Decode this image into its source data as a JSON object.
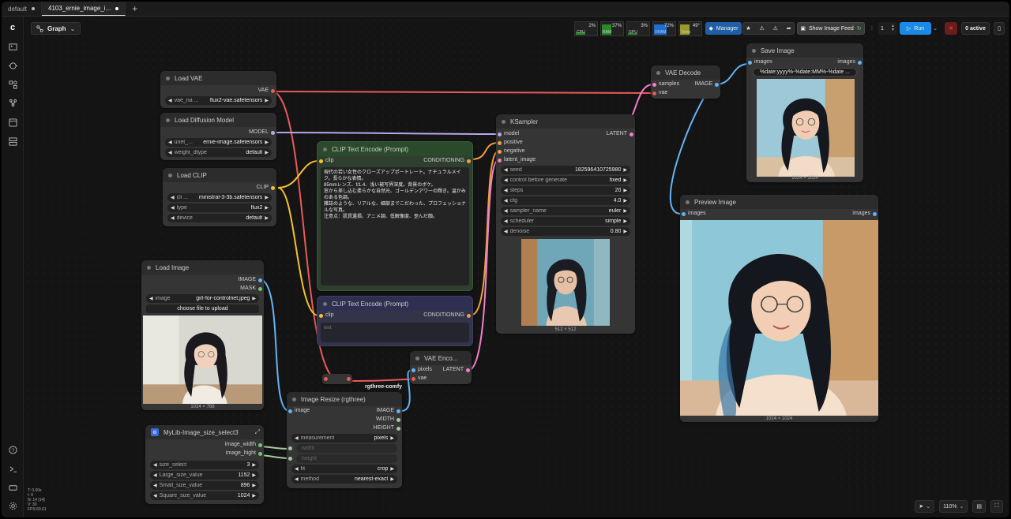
{
  "tabs": [
    {
      "label": "default",
      "active": false
    },
    {
      "label": "4103_ernie_image_i...",
      "active": true
    }
  ],
  "toolbar": {
    "graph_label": "Graph",
    "stats": [
      {
        "label": "CPU",
        "value": "2%",
        "color": "#2a8a2a"
      },
      {
        "label": "RAM",
        "value": "37%",
        "color": "#2a8a2a"
      },
      {
        "label": "GPU",
        "value": "3%",
        "color": "#2a8a2a"
      },
      {
        "label": "VRAM",
        "value": "72%",
        "color": "#1f6fd1"
      },
      {
        "label": "Temp",
        "value": "49°",
        "color": "#9a9a2a"
      }
    ],
    "manager_label": "Manager",
    "show_image_feed_label": "Show Image Feed",
    "batch_count": "1",
    "run_label": "Run",
    "active_label": "0 active",
    "zoom": "110%"
  },
  "stats_overlay": [
    "T: 0.00s",
    "I: 0",
    "N: 14 [14]",
    "V: 30",
    "FPS:60.61"
  ],
  "nodes": {
    "load_vae": {
      "title": "Load VAE",
      "out": "VAE",
      "w_label": "vae_na ...",
      "w_value": "flux2-vae.safetensors"
    },
    "load_diffusion": {
      "title": "Load Diffusion Model",
      "out": "MODEL",
      "w1_label": "unet_...",
      "w1_value": "ernie-image.safetensors",
      "w2_label": "weight_dtype",
      "w2_value": "default"
    },
    "load_clip": {
      "title": "Load CLIP",
      "out": "CLIP",
      "w1_label": "cli ...",
      "w1_value": "ministral-3-3b.safetensors",
      "w2_label": "type",
      "w2_value": "flux2",
      "w3_label": "device",
      "w3_value": "default"
    },
    "clip_pos": {
      "title": "CLIP Text Encode (Prompt)",
      "in": "clip",
      "out": "CONDITIONING",
      "text": "現代の若い女性のクローズアップポートレート。ナチュラルメイク。長らかな表情。\n85mmレンズ、f/1.4、浅い被写界深度。背景のボケ。\n窓から差し込む柔らかな自然光、ゴールデンアワーの輝き。温かみのある色調。\n雑誌のような、リアルな、細部までこだわった、プロフェッショナルな写真。\n注意点：肌質遺損、アニメ調、低解像度、歪んだ顔。"
    },
    "clip_neg": {
      "title": "CLIP Text Encode (Prompt)",
      "in": "clip",
      "out": "CONDITIONING",
      "placeholder": "text"
    },
    "ksampler": {
      "title": "KSampler",
      "inputs": [
        "model",
        "positive",
        "negative",
        "latent_image"
      ],
      "out": "LATENT",
      "widgets": [
        {
          "label": "seed",
          "value": "182596410725980"
        },
        {
          "label": "control before generate",
          "value": "fixed"
        },
        {
          "label": "steps",
          "value": "20"
        },
        {
          "label": "cfg",
          "value": "4.0"
        },
        {
          "label": "sampler_name",
          "value": "euler"
        },
        {
          "label": "scheduler",
          "value": "simple"
        },
        {
          "label": "denoise",
          "value": "0.80"
        }
      ],
      "caption": "512 × 512"
    },
    "vae_decode": {
      "title": "VAE Decode",
      "in1": "samples",
      "in2": "vae",
      "out": "IMAGE"
    },
    "save_image": {
      "title": "Save Image",
      "in": "images",
      "out": "images",
      "prefix": "%date:yyyy%-%date:MM%-%date ...",
      "caption": "1024 × 1024"
    },
    "preview_image": {
      "title": "Preview Image",
      "in": "images",
      "out": "images",
      "caption": "1024 × 1024"
    },
    "load_image": {
      "title": "Load Image",
      "out1": "IMAGE",
      "out2": "MASK",
      "w_label": "image",
      "w_value": "girl-for-controlnet.jpeg",
      "upload_label": "choose file to upload",
      "caption": "1024 × 768"
    },
    "vae_encode": {
      "title": "VAE Enco...",
      "in1": "pixels",
      "in2": "vae",
      "out": "LATENT"
    },
    "reroute_label": "rgthree-comfy",
    "image_resize": {
      "title": "Image Resize (rgthree)",
      "in": "image",
      "outs": [
        "IMAGE",
        "WIDTH",
        "HEIGHT"
      ],
      "widgets": [
        {
          "label": "measurement",
          "value": "pixels"
        },
        {
          "label": "width",
          "value": ""
        },
        {
          "label": "height",
          "value": ""
        },
        {
          "label": "fit",
          "value": "crop"
        },
        {
          "label": "method",
          "value": "nearest-exact"
        }
      ]
    },
    "mylib": {
      "title": "MyLib-Image_size_select3",
      "outs": [
        "image_width",
        "image_hight"
      ],
      "widgets": [
        {
          "label": "size_select",
          "value": "3"
        },
        {
          "label": "Large_size_value",
          "value": "1152"
        },
        {
          "label": "Small_size_value",
          "value": "896"
        },
        {
          "label": "Square_size_value",
          "value": "1024"
        }
      ]
    }
  }
}
